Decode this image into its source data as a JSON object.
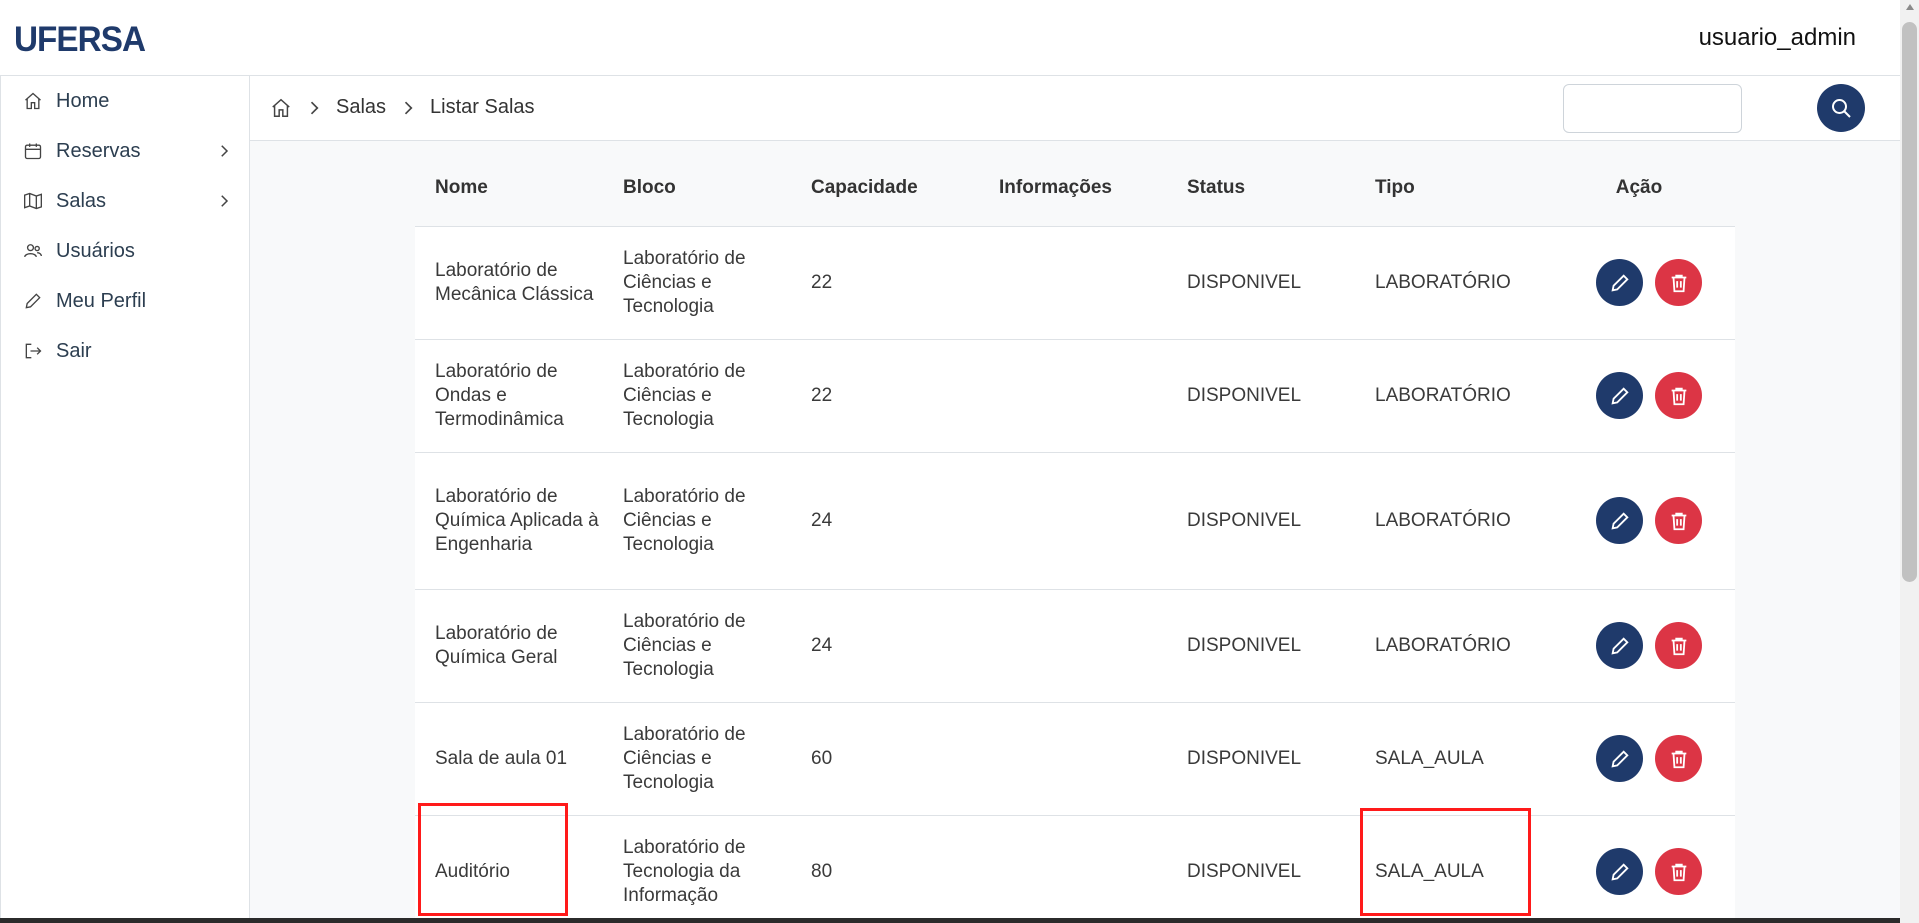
{
  "header": {
    "logo": "UFERSA",
    "user": "usuario_admin"
  },
  "sidebar": {
    "items": [
      {
        "label": "Home",
        "icon": "home-icon",
        "has_submenu": false
      },
      {
        "label": "Reservas",
        "icon": "calendar-icon",
        "has_submenu": true
      },
      {
        "label": "Salas",
        "icon": "map-icon",
        "has_submenu": true
      },
      {
        "label": "Usuários",
        "icon": "users-icon",
        "has_submenu": false
      },
      {
        "label": "Meu Perfil",
        "icon": "pencil-icon",
        "has_submenu": false
      },
      {
        "label": "Sair",
        "icon": "logout-icon",
        "has_submenu": false
      }
    ]
  },
  "breadcrumb": {
    "level1": "Salas",
    "level2": "Listar Salas"
  },
  "search": {
    "value": "",
    "placeholder": ""
  },
  "table": {
    "headers": [
      "Nome",
      "Bloco",
      "Capacidade",
      "Informações",
      "Status",
      "Tipo",
      "Ação"
    ],
    "rows": [
      {
        "nome": "Laboratório de Mecânica Clássica",
        "bloco": "Laboratório de Ciências e Tecnologia",
        "capacidade": "22",
        "informacoes": "",
        "status": "DISPONIVEL",
        "tipo": "LABORATÓRIO"
      },
      {
        "nome": "Laboratório de Ondas e Termodinâmica",
        "bloco": "Laboratório de Ciências e Tecnologia",
        "capacidade": "22",
        "informacoes": "",
        "status": "DISPONIVEL",
        "tipo": "LABORATÓRIO"
      },
      {
        "nome": "Laboratório de Química Aplicada à Engenharia",
        "bloco": "Laboratório de Ciências e Tecnologia",
        "capacidade": "24",
        "informacoes": "",
        "status": "DISPONIVEL",
        "tipo": "LABORATÓRIO"
      },
      {
        "nome": "Laboratório de Química Geral",
        "bloco": "Laboratório de Ciências e Tecnologia",
        "capacidade": "24",
        "informacoes": "",
        "status": "DISPONIVEL",
        "tipo": "LABORATÓRIO"
      },
      {
        "nome": "Sala de aula 01",
        "bloco": "Laboratório de Ciências e Tecnologia",
        "capacidade": "60",
        "informacoes": "",
        "status": "DISPONIVEL",
        "tipo": "SALA_AULA"
      },
      {
        "nome": "Auditório",
        "bloco": "Laboratório de Tecnologia da Informação",
        "capacidade": "80",
        "informacoes": "",
        "status": "DISPONIVEL",
        "tipo": "SALA_AULA"
      }
    ]
  },
  "colors": {
    "primary": "#1f3a6b",
    "danger": "#dc3545",
    "highlight": "#ff1a1a"
  }
}
